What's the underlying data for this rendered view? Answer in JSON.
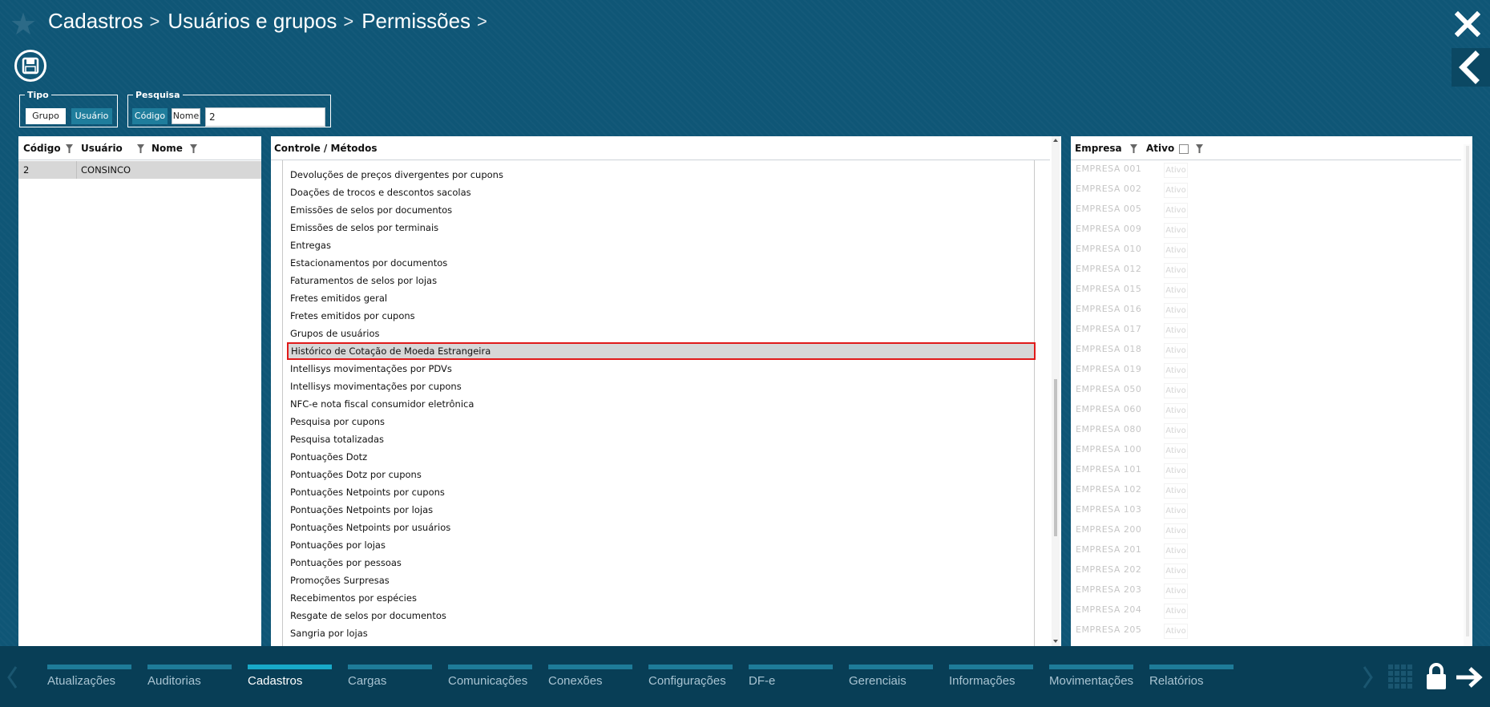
{
  "header": {
    "breadcrumb": [
      "Cadastros",
      "Usuários e grupos",
      "Permissões"
    ],
    "separator": ">"
  },
  "filters": {
    "tipo": {
      "legend": "Tipo",
      "options": [
        "Grupo",
        "Usuário"
      ],
      "selected": "Usuário"
    },
    "pesquisa": {
      "legend": "Pesquisa",
      "options": [
        "Código",
        "Nome"
      ],
      "selected": "Código",
      "value": "2"
    }
  },
  "users_table": {
    "columns": [
      "Código",
      "Usuário",
      "Nome"
    ],
    "rows": [
      {
        "codigo": "2",
        "usuario": "CONSINCO",
        "nome": ""
      }
    ]
  },
  "control_panel": {
    "header": "Controle / Métodos",
    "items": [
      "Devoluções de preços divergentes por cupons",
      "Doações de trocos e descontos sacolas",
      "Emissões de selos por documentos",
      "Emissões de selos por terminais",
      "Entregas",
      "Estacionamentos por documentos",
      "Faturamentos de selos por lojas",
      "Fretes emitidos geral",
      "Fretes emitidos por cupons",
      "Grupos de usuários",
      "Histórico de Cotação de Moeda Estrangeira",
      "Intellisys movimentações por PDVs",
      "Intellisys movimentações por cupons",
      "NFC-e nota fiscal consumidor eletrônica",
      "Pesquisa por cupons",
      "Pesquisa totalizadas",
      "Pontuações Dotz",
      "Pontuações Dotz por cupons",
      "Pontuações Netpoints por cupons",
      "Pontuações Netpoints por lojas",
      "Pontuações Netpoints por usuários",
      "Pontuações por lojas",
      "Pontuações por pessoas",
      "Promoções Surpresas",
      "Recebimentos por espécies",
      "Resgate de selos por documentos",
      "Sangria por lojas"
    ],
    "selected_index": 10
  },
  "company_panel": {
    "columns": [
      "Empresa",
      "Ativo"
    ],
    "ativo_label": "Ativo",
    "companies": [
      "EMPRESA 001",
      "EMPRESA 002",
      "EMPRESA 005",
      "EMPRESA 009",
      "EMPRESA 010",
      "EMPRESA 012",
      "EMPRESA 015",
      "EMPRESA 016",
      "EMPRESA 017",
      "EMPRESA 018",
      "EMPRESA 019",
      "EMPRESA 050",
      "EMPRESA 060",
      "EMPRESA 080",
      "EMPRESA 100",
      "EMPRESA 101",
      "EMPRESA 102",
      "EMPRESA 103",
      "EMPRESA 200",
      "EMPRESA 201",
      "EMPRESA 202",
      "EMPRESA 203",
      "EMPRESA 204",
      "EMPRESA 205"
    ]
  },
  "bottom_nav": {
    "items": [
      "Atualizações",
      "Auditorias",
      "Cadastros",
      "Cargas",
      "Comunicações",
      "Conexões",
      "Configurações",
      "DF-e",
      "Gerenciais",
      "Informações",
      "Movimentações",
      "Relatórios"
    ],
    "active": "Cadastros"
  },
  "colors": {
    "background": "#0f5676",
    "bottom_bar": "#083e56",
    "accent": "#1f7d9c",
    "selection_border": "#e01a1a"
  }
}
